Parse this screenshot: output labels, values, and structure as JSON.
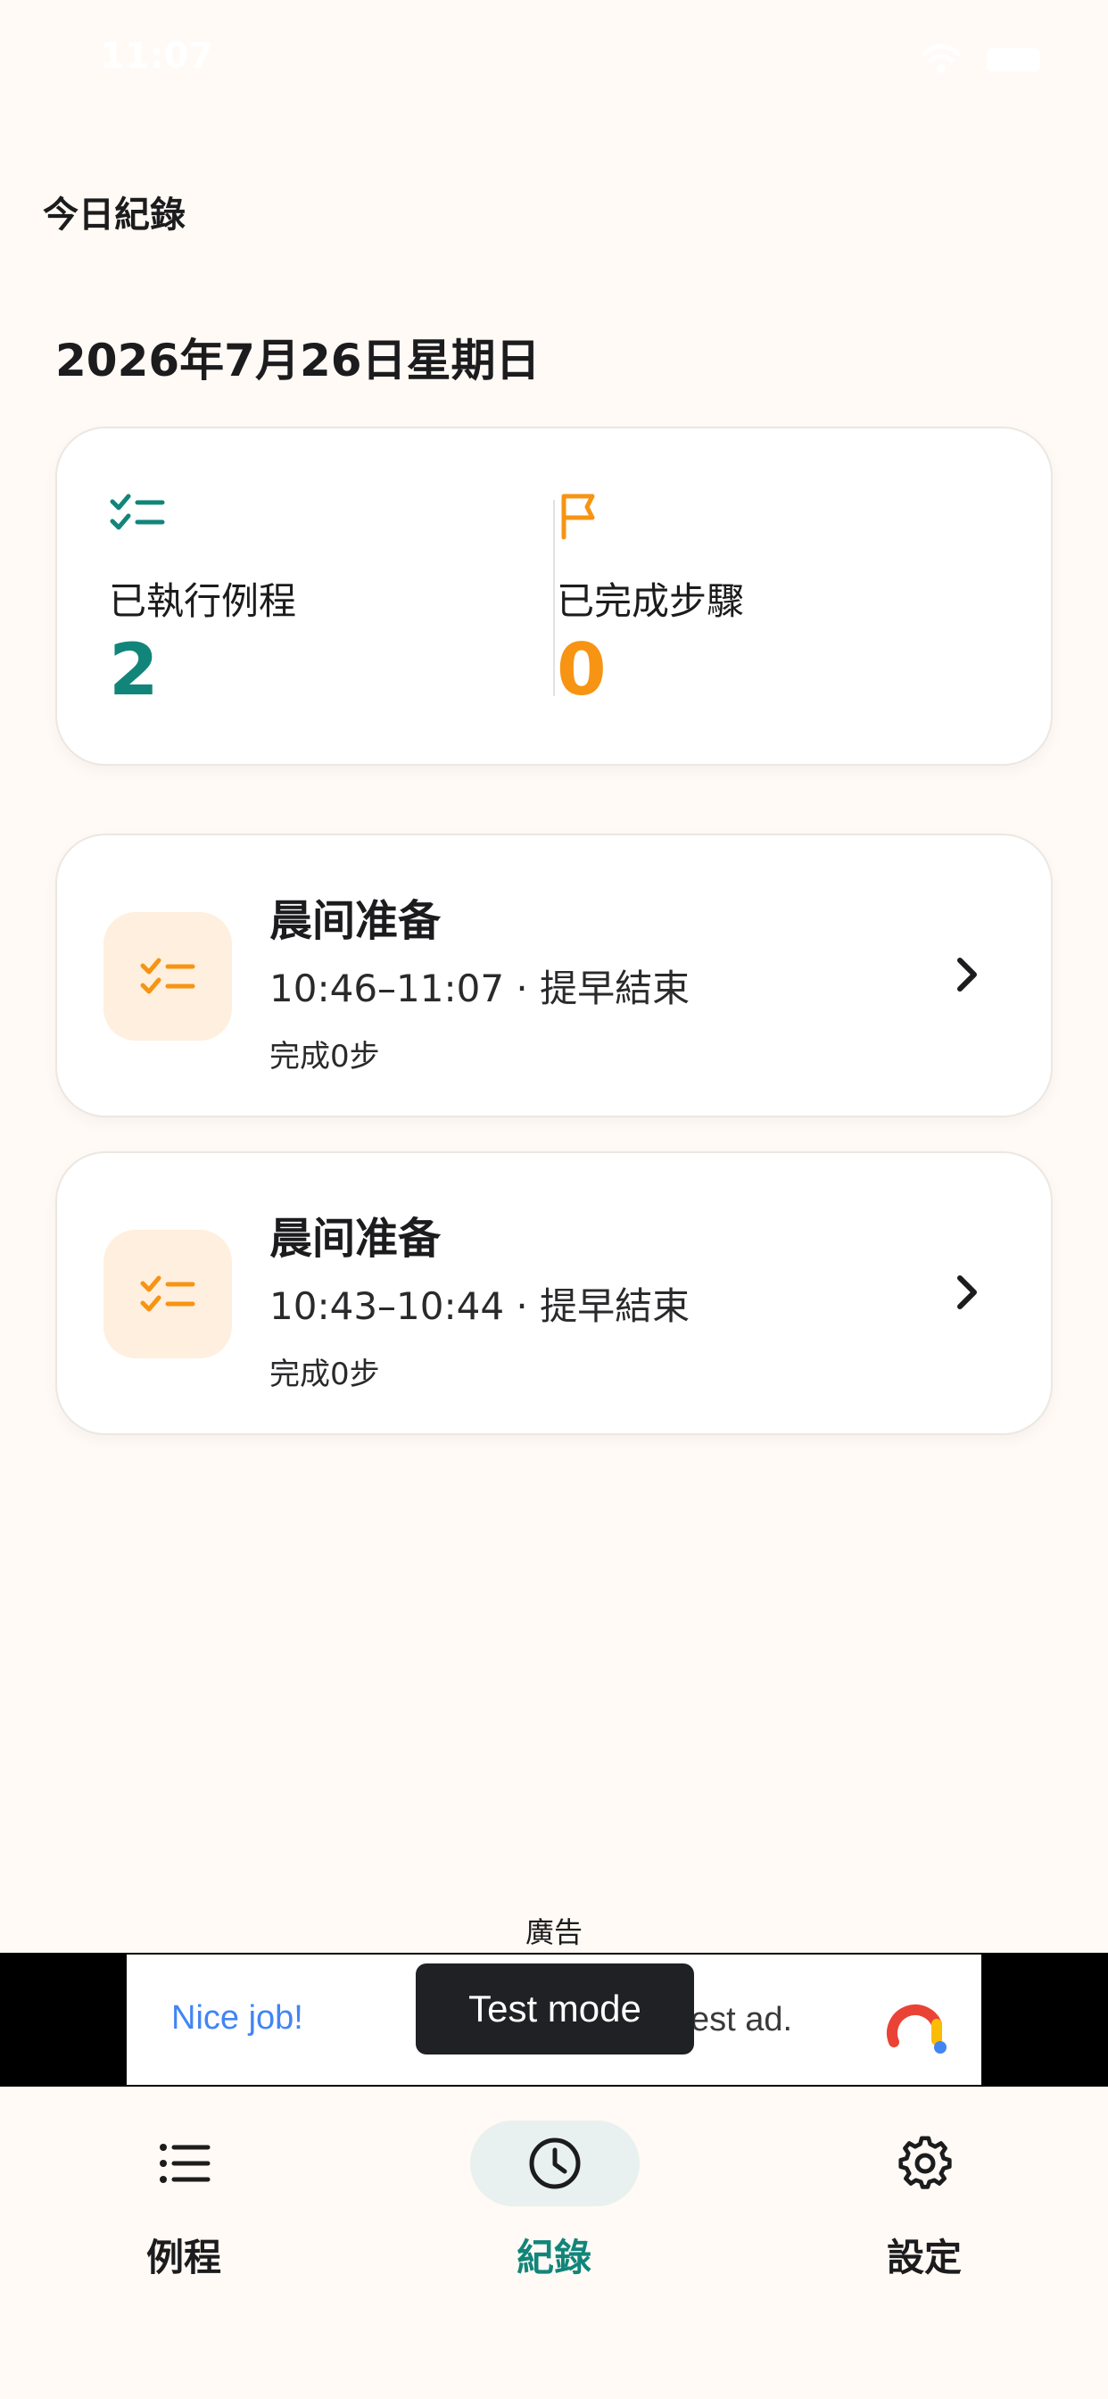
{
  "status_bar": {
    "time": "11:07"
  },
  "header": {
    "title": "今日紀錄",
    "date": "2026年7月26日星期日"
  },
  "stats": {
    "routines_run": {
      "label": "已執行例程",
      "value": "2",
      "color": "#12857A",
      "icon": "checklist-icon"
    },
    "steps_completed": {
      "label": "已完成步驟",
      "value": "0",
      "color": "#F79413",
      "icon": "flag-icon"
    }
  },
  "sessions": [
    {
      "title": "晨间准备",
      "time": "10:46–11:07 · 提早結束",
      "steps": "完成0步",
      "icon": "checklist-icon"
    },
    {
      "title": "晨间准备",
      "time": "10:43–10:44 · 提早結束",
      "steps": "完成0步",
      "icon": "checklist-icon"
    }
  ],
  "ad": {
    "label": "廣告",
    "headline": "Nice job!",
    "body": "est ad.",
    "tooltip": "Test mode"
  },
  "bottom_nav": {
    "items": [
      {
        "label": "例程",
        "icon": "list-icon",
        "active": false
      },
      {
        "label": "紀錄",
        "icon": "clock-icon",
        "active": true
      },
      {
        "label": "設定",
        "icon": "gear-icon",
        "active": false
      }
    ],
    "accent": "#12857A"
  }
}
